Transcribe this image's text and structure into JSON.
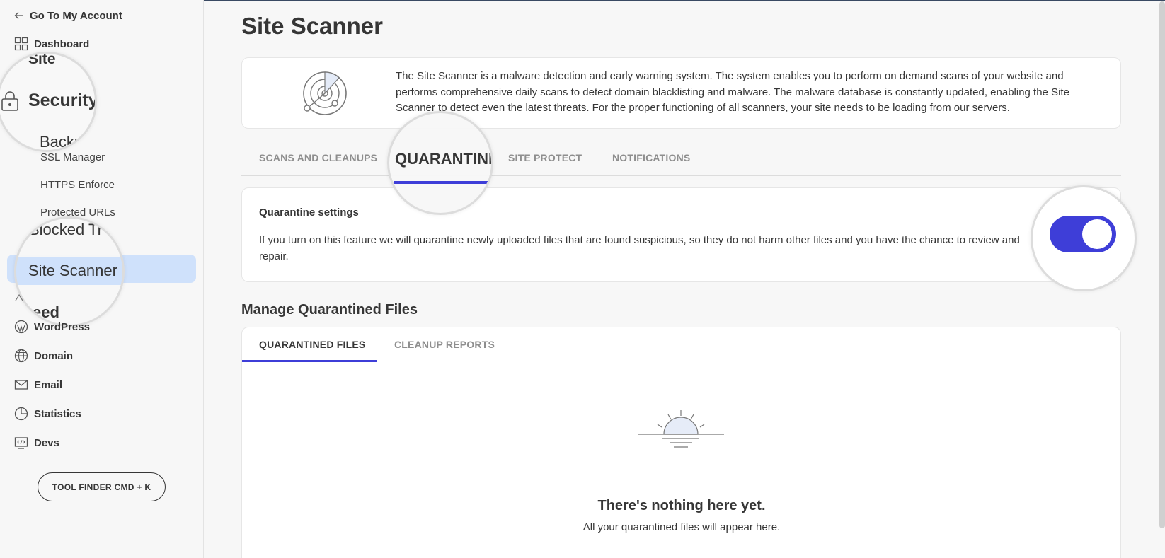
{
  "sidebar": {
    "back_link": "Go To My Account",
    "dashboard": "Dashboard",
    "site": "Site",
    "security": "Security",
    "backups": "Backu",
    "ssl_manager": "SSL Manager",
    "https_enforce": "HTTPS Enforce",
    "protected_urls": "Protected URLs",
    "blocked_traffic": "Blocked Tr",
    "site_scanner": "Site Scanner",
    "speed": "eed",
    "wordpress": "WordPress",
    "domain": "Domain",
    "email": "Email",
    "statistics": "Statistics",
    "devs": "Devs",
    "tool_finder": "TOOL FINDER CMD + K"
  },
  "main": {
    "title": "Site Scanner",
    "intro": "The Site Scanner is a malware detection and early warning system. The system enables you to perform on demand scans of your website and performs comprehensive daily scans to detect domain blacklisting and malware. The malware database is constantly updated, enabling the Site Scanner to detect even the latest threats. For the proper functioning of all scanners, your site needs to be loading from our servers.",
    "tabs": [
      {
        "label": "SCANS AND CLEANUPS"
      },
      {
        "label": "QUARANTINE"
      },
      {
        "label": "SITE PROTECT"
      },
      {
        "label": "NOTIFICATIONS"
      }
    ],
    "quarantine": {
      "title": "Quarantine settings",
      "description": "If you turn on this feature we will quarantine newly uploaded files that are found suspicious, so they do not harm other files and you have the chance to review and repair.",
      "toggle_on": true
    },
    "manage_title": "Manage Quarantined Files",
    "subtabs": [
      {
        "label": "QUARANTINED FILES"
      },
      {
        "label": "CLEANUP REPORTS"
      }
    ],
    "empty": {
      "title": "There's nothing here yet.",
      "subtitle": "All your quarantined files will appear here."
    }
  },
  "colors": {
    "accent": "#3e3ed8",
    "active_nav_bg": "#cfe1fb",
    "text": "#363636",
    "muted": "#8e8e8e"
  }
}
